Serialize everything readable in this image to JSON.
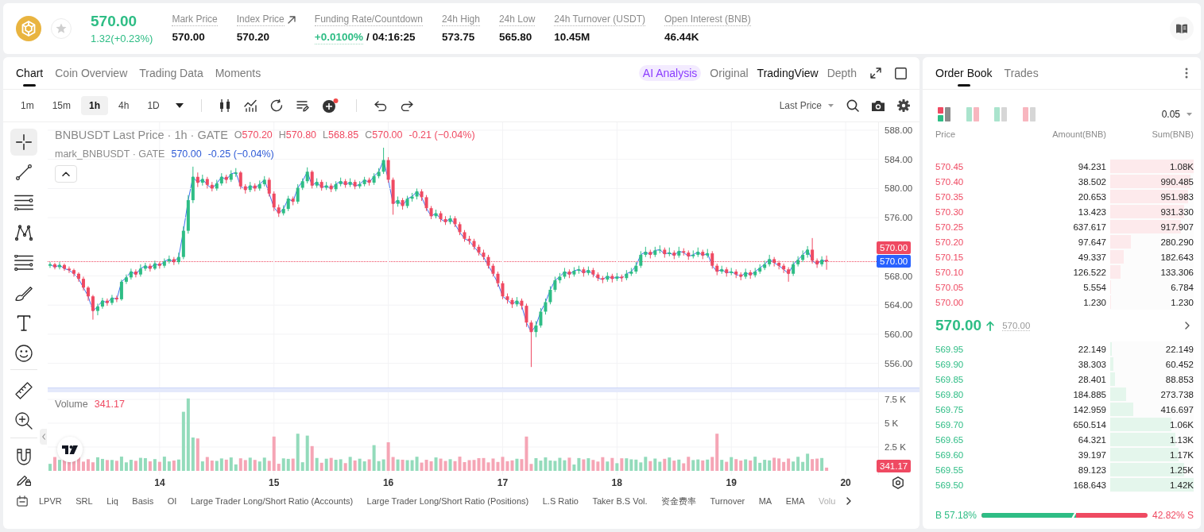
{
  "header": {
    "favorite": false,
    "price": "570.00",
    "change": "1.32(+0.23%)",
    "stats": [
      {
        "kind": "plain",
        "label": "Mark Price",
        "value": "570.00"
      },
      {
        "kind": "link",
        "label": "Index Price",
        "value": "570.20"
      },
      {
        "kind": "funding",
        "label": "Funding Rate/Countdown",
        "value": "+0.0100%",
        "countdown": "/ 04:16:25"
      },
      {
        "kind": "plain",
        "label": "24h High",
        "value": "573.75"
      },
      {
        "kind": "plain",
        "label": "24h Low",
        "value": "565.80"
      },
      {
        "kind": "plain",
        "label": "24h Turnover (USDT)",
        "value": "10.45M"
      },
      {
        "kind": "plain",
        "label": "Open Interest (BNB)",
        "value": "46.44K"
      }
    ]
  },
  "chart_panel": {
    "tabs": [
      {
        "label": "Chart",
        "selected": true
      },
      {
        "label": "Coin Overview",
        "selected": false
      },
      {
        "label": "Trading Data",
        "selected": false
      },
      {
        "label": "Moments",
        "selected": false
      }
    ],
    "ai_analysis": "AI Analysis",
    "views": [
      {
        "label": "Original",
        "selected": false
      },
      {
        "label": "TradingView",
        "selected": true
      },
      {
        "label": "Depth",
        "selected": false
      }
    ],
    "intervals": [
      {
        "label": "1m",
        "selected": false
      },
      {
        "label": "15m",
        "selected": false
      },
      {
        "label": "1h",
        "selected": true
      },
      {
        "label": "4h",
        "selected": false
      },
      {
        "label": "1D",
        "selected": false
      }
    ],
    "price_source": "Last Price",
    "draw_tool_groups": [
      [
        {
          "kind": "crosshair",
          "selected": true
        },
        {
          "kind": "trend_line",
          "selected": false
        },
        {
          "kind": "parallel_lines",
          "selected": false
        },
        {
          "kind": "pattern",
          "selected": false
        },
        {
          "kind": "fib",
          "selected": false
        },
        {
          "kind": "brush",
          "selected": false
        },
        {
          "kind": "text",
          "selected": false
        },
        {
          "kind": "emoji",
          "selected": false
        }
      ],
      [
        {
          "kind": "ruler",
          "selected": false
        },
        {
          "kind": "zoom",
          "selected": false
        }
      ],
      [
        {
          "kind": "magnet",
          "selected": false
        },
        {
          "kind": "lock_draw",
          "selected": false
        }
      ]
    ],
    "legend": {
      "symbol": "BNBUSDT Last Price · 1h · GATE",
      "ohlc": [
        {
          "key": "O",
          "value": "570.20"
        },
        {
          "key": "H",
          "value": "570.80"
        },
        {
          "key": "L",
          "value": "568.85"
        },
        {
          "key": "C",
          "value": "570.00"
        }
      ],
      "change": "-0.21 (−0.04%)",
      "mark_symbol": "mark_BNBUSDT · GATE",
      "mark_value": "570.00",
      "mark_change": "-0.25 (−0.04%)"
    },
    "price_chart": {
      "chart_data": {
        "type": "candlestick",
        "grid": true,
        "categories": [
          null,
          null,
          null,
          null,
          null,
          null,
          null,
          null,
          null,
          null,
          null,
          null,
          null,
          null,
          null,
          null,
          null,
          null,
          null,
          null,
          null,
          null,
          null,
          "14",
          null,
          null,
          null,
          null,
          null,
          null,
          null,
          null,
          null,
          null,
          null,
          null,
          null,
          null,
          null,
          null,
          null,
          null,
          null,
          null,
          null,
          null,
          null,
          "15",
          null,
          null,
          null,
          null,
          null,
          null,
          null,
          null,
          null,
          null,
          null,
          null,
          null,
          null,
          null,
          null,
          null,
          null,
          null,
          null,
          null,
          null,
          null,
          "16",
          null,
          null,
          null,
          null,
          null,
          null,
          null,
          null,
          null,
          null,
          null,
          null,
          null,
          null,
          null,
          null,
          null,
          null,
          null,
          null,
          null,
          null,
          null,
          "17",
          null,
          null,
          null,
          null,
          null,
          null,
          null,
          null,
          null,
          null,
          null,
          null,
          null,
          null,
          null,
          null,
          null,
          null,
          null,
          null,
          null,
          null,
          null,
          "18",
          null,
          null,
          null,
          null,
          null,
          null,
          null,
          null,
          null,
          null,
          null,
          null,
          null,
          null,
          null,
          null,
          null,
          null,
          null,
          null,
          null,
          null,
          null,
          "19",
          null,
          null,
          null,
          null,
          null,
          null,
          null,
          null,
          null,
          null,
          null,
          null,
          null,
          null,
          null,
          null,
          null,
          null,
          null,
          null,
          null,
          null,
          null,
          "20",
          null,
          null,
          null,
          null,
          null,
          null,
          null,
          null,
          null,
          null,
          null,
          null,
          null,
          null,
          null
        ],
        "ohlc": [
          [
            569.4,
            569.9,
            569.1,
            569.6
          ],
          [
            569.6,
            569.8,
            568.9,
            569.2
          ],
          [
            569.2,
            569.9,
            568.9,
            569.5
          ],
          [
            569.5,
            569.7,
            568.7,
            569.0
          ],
          [
            569.0,
            569.3,
            568.4,
            568.8
          ],
          [
            568.8,
            569.0,
            567.9,
            568.3
          ],
          [
            568.3,
            568.5,
            567.2,
            567.6
          ],
          [
            567.6,
            567.9,
            566.0,
            566.4
          ],
          [
            566.4,
            566.6,
            564.6,
            565.2
          ],
          [
            565.2,
            565.4,
            562.0,
            563.2
          ],
          [
            563.2,
            564.2,
            562.6,
            563.8
          ],
          [
            563.8,
            565.0,
            563.5,
            564.6
          ],
          [
            564.6,
            564.9,
            563.9,
            564.3
          ],
          [
            564.3,
            565.4,
            564.0,
            565.0
          ],
          [
            565.0,
            565.3,
            564.4,
            564.8
          ],
          [
            564.8,
            567.5,
            564.6,
            567.2
          ],
          [
            567.2,
            568.2,
            566.9,
            567.8
          ],
          [
            567.8,
            569.0,
            567.5,
            568.6
          ],
          [
            568.6,
            568.9,
            567.8,
            568.2
          ],
          [
            568.2,
            569.6,
            567.9,
            569.0
          ],
          [
            569.0,
            569.8,
            568.7,
            569.4
          ],
          [
            569.4,
            569.7,
            568.6,
            569.0
          ],
          [
            569.0,
            570.1,
            568.8,
            569.7
          ],
          [
            569.7,
            570.0,
            569.0,
            569.4
          ],
          [
            569.4,
            570.4,
            569.1,
            570.0
          ],
          [
            570.0,
            570.8,
            569.7,
            570.3
          ],
          [
            570.3,
            570.6,
            569.5,
            569.9
          ],
          [
            569.9,
            571.2,
            569.6,
            570.6
          ],
          [
            570.6,
            574.8,
            570.3,
            574.2
          ],
          [
            574.2,
            579.1,
            573.8,
            578.4
          ],
          [
            578.4,
            583.0,
            578.0,
            581.6
          ],
          [
            581.6,
            582.2,
            580.2,
            580.8
          ],
          [
            580.8,
            581.9,
            580.4,
            581.3
          ],
          [
            581.3,
            581.6,
            580.0,
            580.5
          ],
          [
            580.5,
            580.9,
            579.6,
            580.0
          ],
          [
            580.0,
            581.2,
            579.7,
            580.7
          ],
          [
            580.7,
            582.1,
            580.4,
            581.6
          ],
          [
            581.6,
            581.9,
            580.7,
            581.2
          ],
          [
            581.2,
            582.5,
            580.9,
            582.0
          ],
          [
            582.0,
            582.8,
            581.6,
            582.2
          ],
          [
            582.2,
            582.4,
            579.9,
            580.3
          ],
          [
            580.3,
            580.6,
            579.3,
            579.8
          ],
          [
            579.8,
            580.9,
            579.5,
            580.4
          ],
          [
            580.4,
            580.7,
            579.6,
            580.0
          ],
          [
            580.0,
            581.1,
            579.7,
            580.6
          ],
          [
            580.6,
            581.7,
            580.3,
            581.2
          ],
          [
            581.2,
            581.5,
            578.9,
            579.3
          ],
          [
            579.3,
            579.6,
            576.9,
            577.4
          ],
          [
            577.4,
            577.8,
            576.1,
            576.6
          ],
          [
            576.6,
            577.7,
            576.3,
            577.2
          ],
          [
            577.2,
            579.0,
            576.9,
            578.6
          ],
          [
            578.6,
            578.9,
            577.7,
            578.2
          ],
          [
            578.2,
            580.6,
            577.9,
            580.1
          ],
          [
            580.1,
            581.4,
            579.8,
            581.0
          ],
          [
            581.0,
            582.9,
            580.7,
            582.3
          ],
          [
            582.3,
            582.5,
            580.0,
            580.4
          ],
          [
            580.4,
            581.4,
            580.1,
            580.9
          ],
          [
            580.9,
            581.2,
            579.7,
            580.1
          ],
          [
            580.1,
            580.9,
            579.8,
            580.4
          ],
          [
            580.4,
            580.7,
            579.5,
            579.9
          ],
          [
            579.9,
            581.0,
            579.6,
            580.6
          ],
          [
            580.6,
            581.5,
            580.3,
            581.0
          ],
          [
            581.0,
            581.3,
            580.1,
            580.5
          ],
          [
            580.5,
            581.4,
            580.2,
            580.9
          ],
          [
            580.9,
            581.2,
            579.9,
            580.3
          ],
          [
            580.3,
            581.0,
            580.0,
            580.6
          ],
          [
            580.6,
            581.6,
            580.3,
            581.2
          ],
          [
            581.2,
            581.5,
            580.4,
            580.8
          ],
          [
            580.8,
            582.1,
            580.5,
            581.7
          ],
          [
            581.7,
            582.8,
            581.4,
            582.3
          ],
          [
            582.3,
            585.6,
            582.0,
            583.9
          ],
          [
            583.9,
            584.3,
            580.8,
            581.2
          ],
          [
            581.2,
            581.5,
            576.4,
            577.9
          ],
          [
            577.9,
            578.9,
            577.5,
            578.4
          ],
          [
            578.4,
            578.7,
            577.1,
            577.6
          ],
          [
            577.6,
            579.0,
            577.3,
            578.6
          ],
          [
            578.6,
            579.4,
            578.2,
            578.9
          ],
          [
            578.9,
            580.0,
            578.5,
            579.6
          ],
          [
            579.6,
            579.9,
            578.3,
            578.8
          ],
          [
            578.8,
            579.1,
            576.9,
            577.3
          ],
          [
            577.3,
            577.6,
            575.8,
            576.2
          ],
          [
            576.2,
            577.1,
            575.9,
            576.6
          ],
          [
            576.6,
            576.9,
            575.4,
            575.8
          ],
          [
            575.8,
            576.2,
            575.0,
            575.4
          ],
          [
            575.4,
            576.3,
            575.1,
            575.9
          ],
          [
            575.9,
            576.2,
            574.7,
            575.1
          ],
          [
            575.1,
            575.4,
            573.6,
            574.0
          ],
          [
            574.0,
            574.3,
            572.7,
            573.1
          ],
          [
            573.1,
            573.5,
            572.3,
            572.8
          ],
          [
            572.8,
            573.1,
            571.6,
            572.0
          ],
          [
            572.0,
            572.3,
            570.8,
            571.2
          ],
          [
            571.2,
            571.6,
            570.2,
            570.6
          ],
          [
            570.6,
            570.9,
            569.0,
            569.4
          ],
          [
            569.4,
            569.7,
            567.9,
            568.3
          ],
          [
            568.3,
            568.6,
            566.5,
            567.0
          ],
          [
            567.0,
            567.3,
            564.8,
            565.2
          ],
          [
            565.2,
            565.6,
            564.2,
            564.7
          ],
          [
            564.7,
            565.0,
            563.6,
            564.1
          ],
          [
            564.1,
            565.1,
            563.8,
            564.6
          ],
          [
            564.6,
            564.9,
            563.4,
            563.9
          ],
          [
            563.9,
            564.2,
            561.0,
            561.6
          ],
          [
            561.6,
            561.9,
            555.5,
            560.3
          ],
          [
            560.3,
            561.8,
            559.6,
            561.2
          ],
          [
            561.2,
            563.6,
            560.9,
            563.1
          ],
          [
            563.1,
            564.9,
            562.7,
            564.4
          ],
          [
            564.4,
            566.6,
            564.1,
            566.1
          ],
          [
            566.1,
            567.9,
            565.8,
            567.4
          ],
          [
            567.4,
            568.4,
            567.0,
            567.9
          ],
          [
            567.9,
            569.1,
            567.6,
            568.6
          ],
          [
            568.6,
            568.9,
            567.7,
            568.2
          ],
          [
            568.2,
            569.2,
            567.9,
            568.7
          ],
          [
            568.7,
            569.4,
            568.3,
            568.9
          ],
          [
            568.9,
            569.2,
            567.9,
            568.4
          ],
          [
            568.4,
            569.3,
            568.1,
            568.8
          ],
          [
            568.8,
            569.1,
            567.8,
            568.2
          ],
          [
            568.2,
            568.5,
            567.3,
            567.7
          ],
          [
            567.7,
            568.0,
            567.0,
            567.5
          ],
          [
            567.5,
            568.5,
            567.2,
            568.0
          ],
          [
            568.0,
            568.3,
            567.1,
            567.6
          ],
          [
            567.6,
            568.4,
            567.3,
            567.9
          ],
          [
            567.9,
            568.2,
            567.2,
            567.7
          ],
          [
            567.7,
            568.8,
            567.4,
            568.3
          ],
          [
            568.3,
            569.1,
            568.0,
            568.6
          ],
          [
            568.6,
            569.9,
            568.3,
            569.4
          ],
          [
            569.4,
            571.4,
            569.1,
            570.9
          ],
          [
            570.9,
            572.0,
            570.6,
            571.3
          ],
          [
            571.3,
            571.6,
            570.4,
            570.9
          ],
          [
            570.9,
            572.0,
            570.6,
            571.5
          ],
          [
            571.5,
            572.2,
            571.1,
            571.6
          ],
          [
            571.6,
            571.9,
            570.5,
            571.0
          ],
          [
            571.0,
            571.9,
            570.7,
            571.2
          ],
          [
            571.2,
            571.5,
            570.3,
            570.8
          ],
          [
            570.8,
            572.0,
            570.5,
            571.4
          ],
          [
            571.4,
            571.8,
            570.8,
            571.2
          ],
          [
            571.2,
            571.5,
            570.2,
            570.7
          ],
          [
            570.7,
            571.5,
            570.4,
            570.9
          ],
          [
            570.9,
            571.9,
            570.6,
            571.3
          ],
          [
            571.3,
            571.6,
            570.3,
            570.8
          ],
          [
            570.8,
            571.7,
            570.5,
            571.1
          ],
          [
            571.1,
            571.4,
            569.0,
            569.4
          ],
          [
            569.4,
            569.7,
            568.1,
            568.6
          ],
          [
            568.6,
            569.4,
            568.3,
            568.9
          ],
          [
            568.9,
            569.2,
            567.9,
            568.4
          ],
          [
            568.4,
            569.1,
            568.1,
            568.6
          ],
          [
            568.6,
            568.9,
            567.7,
            568.2
          ],
          [
            568.2,
            568.5,
            567.4,
            567.9
          ],
          [
            567.9,
            569.0,
            567.6,
            568.5
          ],
          [
            568.5,
            568.8,
            567.6,
            568.1
          ],
          [
            568.1,
            569.1,
            567.8,
            568.6
          ],
          [
            568.6,
            569.6,
            568.3,
            569.1
          ],
          [
            569.1,
            570.1,
            568.8,
            569.6
          ],
          [
            569.6,
            570.9,
            569.3,
            570.3
          ],
          [
            570.3,
            570.6,
            569.3,
            569.8
          ],
          [
            569.8,
            570.1,
            568.9,
            569.4
          ],
          [
            569.4,
            569.7,
            568.4,
            568.9
          ],
          [
            568.9,
            569.2,
            567.2,
            568.3
          ],
          [
            568.3,
            570.0,
            568.0,
            569.6
          ],
          [
            569.6,
            570.7,
            569.3,
            570.2
          ],
          [
            570.2,
            571.5,
            569.9,
            570.9
          ],
          [
            570.9,
            572.1,
            570.5,
            571.6
          ],
          [
            571.6,
            573.2,
            569.7,
            570.1
          ],
          [
            570.1,
            570.4,
            569.1,
            569.6
          ],
          [
            569.6,
            570.7,
            569.3,
            570.2
          ],
          [
            570.2,
            570.8,
            568.85,
            570.0
          ],
          null,
          null,
          null,
          null,
          null,
          null,
          null,
          null,
          null,
          null,
          null,
          null,
          null,
          null,
          null,
          null,
          null,
          null,
          null
        ],
        "ylim": [
          540.7,
          589.09
        ],
        "yticks": [
          {
            "value": 588,
            "label": "588.00"
          },
          {
            "value": 584,
            "label": "584.00"
          },
          {
            "value": 580,
            "label": "580.00"
          },
          {
            "value": 576,
            "label": "576.00"
          },
          {
            "value": 568,
            "label": "568.00"
          },
          {
            "value": 564,
            "label": "564.00"
          },
          {
            "value": 560,
            "label": "560.00"
          },
          {
            "value": 556,
            "label": "556.00"
          }
        ]
      },
      "tags": [
        {
          "kind": "last",
          "label": "570.00"
        },
        {
          "kind": "mark",
          "label": "570.00"
        }
      ]
    },
    "volume": {
      "label": "Volume",
      "value": "341.17",
      "axis": [
        {
          "kind": "tick",
          "label": "7.5 K"
        },
        {
          "kind": "tick",
          "label": "5 K"
        },
        {
          "kind": "tick",
          "label": "2.5 K"
        },
        {
          "kind": "tag",
          "label": "341.17"
        }
      ]
    },
    "indicators": [
      "LPVR",
      "SRL",
      "Liq",
      "Basis",
      "OI",
      "Large Trader Long/Short Ratio (Accounts)",
      "Large Trader Long/Short Ratio (Positions)",
      "L.S Ratio",
      "Taker B.S Vol.",
      "资金费率",
      "Turnover",
      "MA",
      "EMA",
      "Volu"
    ]
  },
  "order_book": {
    "tabs": [
      {
        "label": "Order Book",
        "selected": true
      },
      {
        "label": "Trades",
        "selected": false
      }
    ],
    "layouts": [
      {
        "kind": "split",
        "selected": true
      },
      {
        "kind": "both",
        "selected": false
      },
      {
        "kind": "bids",
        "selected": false
      },
      {
        "kind": "asks",
        "selected": false
      }
    ],
    "tick_size": "0.05",
    "columns": [
      "Price",
      "Amount(BNB)",
      "Sum(BNB)"
    ],
    "asks": [
      {
        "price": "570.45",
        "amount": "94.231",
        "sum": "1.08K",
        "level": 1.0
      },
      {
        "price": "570.40",
        "amount": "38.502",
        "sum": "990.485",
        "level": 0.96
      },
      {
        "price": "570.35",
        "amount": "20.653",
        "sum": "951.983",
        "level": 0.93
      },
      {
        "price": "570.30",
        "amount": "13.423",
        "sum": "931.330",
        "level": 0.89
      },
      {
        "price": "570.25",
        "amount": "637.617",
        "sum": "917.907",
        "level": 0.85
      },
      {
        "price": "570.20",
        "amount": "97.647",
        "sum": "280.290",
        "level": 0.25
      },
      {
        "price": "570.15",
        "amount": "49.337",
        "sum": "182.643",
        "level": 0.165
      },
      {
        "price": "570.10",
        "amount": "126.522",
        "sum": "133.306",
        "level": 0.12
      },
      {
        "price": "570.05",
        "amount": "5.554",
        "sum": "6.784",
        "level": 0.01
      },
      {
        "price": "570.00",
        "amount": "1.230",
        "sum": "1.230",
        "level": 0.003
      }
    ],
    "last_price": "570.00",
    "mark_price": "570.00",
    "bids": [
      {
        "price": "569.95",
        "amount": "22.149",
        "sum": "22.149",
        "level": 0.015
      },
      {
        "price": "569.90",
        "amount": "38.303",
        "sum": "60.452",
        "level": 0.04
      },
      {
        "price": "569.85",
        "amount": "28.401",
        "sum": "88.853",
        "level": 0.06
      },
      {
        "price": "569.80",
        "amount": "184.885",
        "sum": "273.738",
        "level": 0.19
      },
      {
        "price": "569.75",
        "amount": "142.959",
        "sum": "416.697",
        "level": 0.28
      },
      {
        "price": "569.70",
        "amount": "650.514",
        "sum": "1.06K",
        "level": 0.73
      },
      {
        "price": "569.65",
        "amount": "64.321",
        "sum": "1.13K",
        "level": 0.78
      },
      {
        "price": "569.60",
        "amount": "39.197",
        "sum": "1.17K",
        "level": 0.82
      },
      {
        "price": "569.55",
        "amount": "89.123",
        "sum": "1.25K",
        "level": 0.89
      },
      {
        "price": "569.50",
        "amount": "168.643",
        "sum": "1.42K",
        "level": 1.0
      }
    ],
    "ratio": {
      "buy": "B 57.18%",
      "sell": "42.82% S",
      "level": 0.5718
    }
  }
}
